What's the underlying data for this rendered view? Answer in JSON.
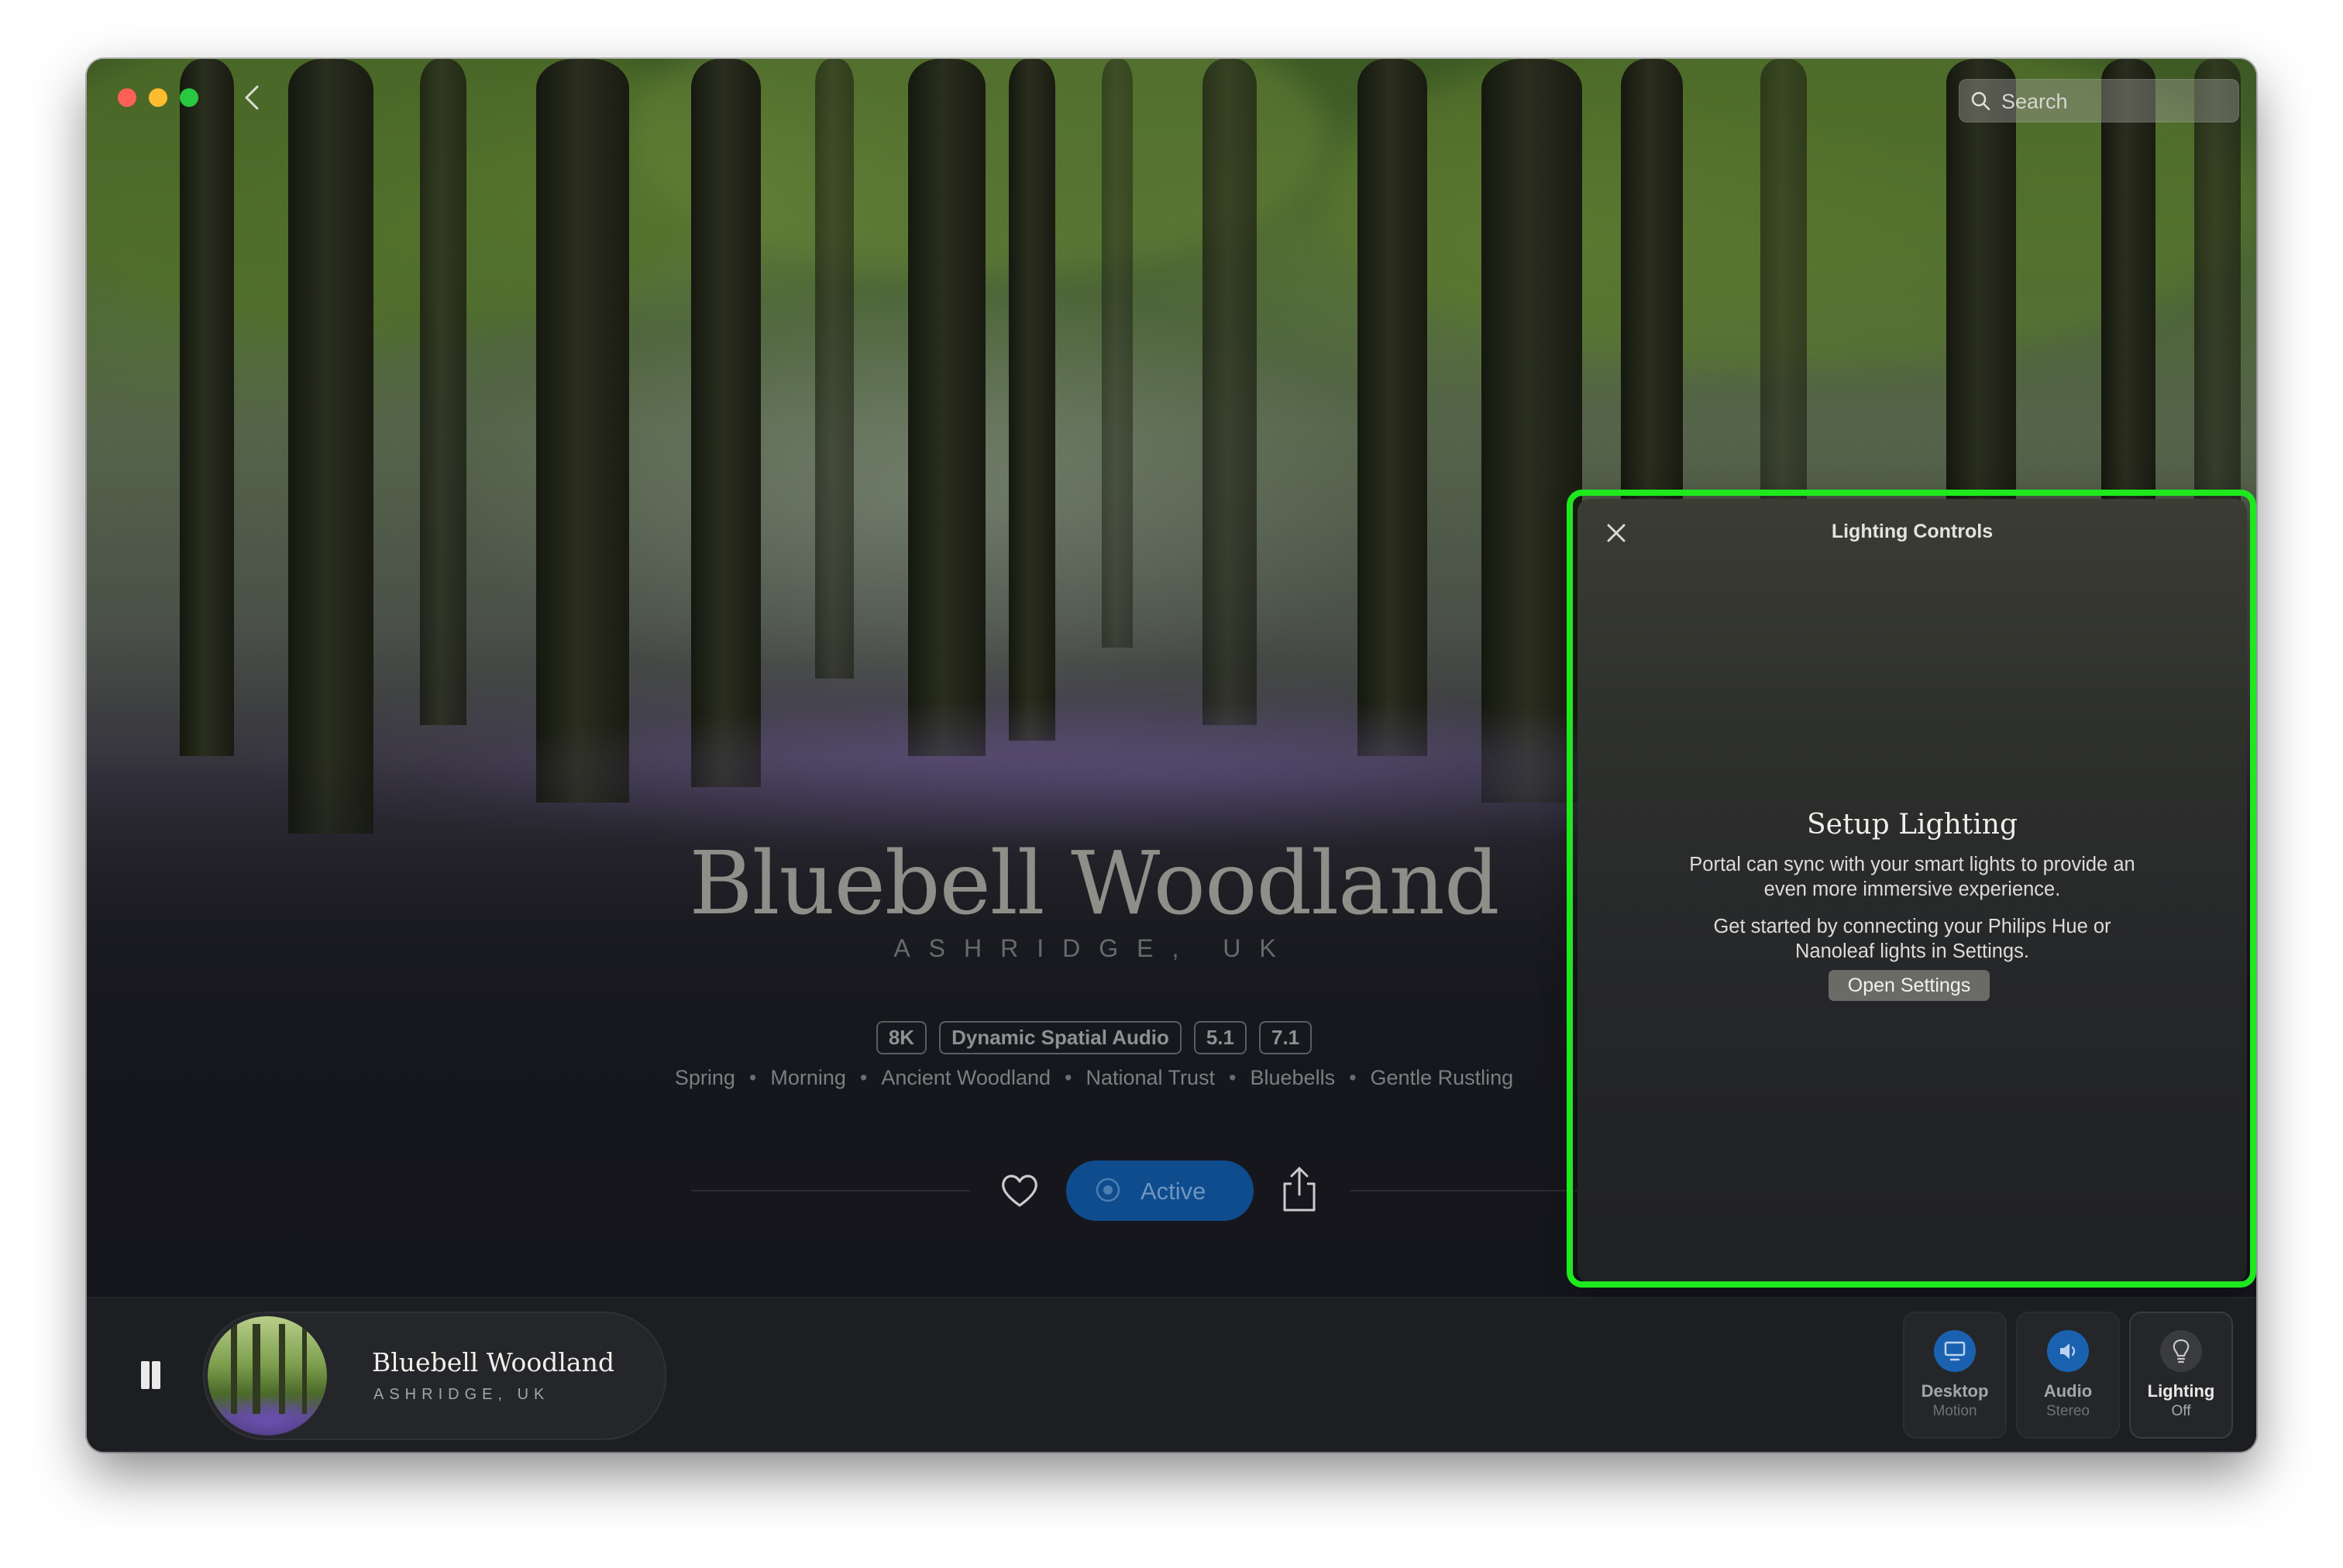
{
  "titlebar": {
    "back_label": "‹",
    "search_placeholder": "Search"
  },
  "hero": {
    "title": "Bluebell Woodland",
    "subtitle": "ASHRIDGE, UK",
    "badges": [
      "8K",
      "Dynamic Spatial Audio",
      "5.1",
      "7.1"
    ],
    "tags": [
      "Spring",
      "Morning",
      "Ancient Woodland",
      "National Trust",
      "Bluebells",
      "Gentle Rustling"
    ]
  },
  "actions": {
    "active_label": "Active"
  },
  "lighting_panel": {
    "title": "Lighting Controls",
    "heading": "Setup Lighting",
    "paragraph_1": "Portal can sync with your smart lights to provide an even more immersive experience.",
    "paragraph_2": "Get started by connecting your Philips Hue or Nanoleaf lights in Settings.",
    "button_label": "Open Settings"
  },
  "now_playing": {
    "title": "Bluebell Woodland",
    "subtitle": "ASHRIDGE, UK"
  },
  "controls": [
    {
      "label": "Desktop",
      "status": "Motion",
      "icon": "monitor-icon",
      "color": "#1a62b0"
    },
    {
      "label": "Audio",
      "status": "Stereo",
      "icon": "speaker-icon",
      "color": "#1a62b0"
    },
    {
      "label": "Lighting",
      "status": "Off",
      "icon": "lightbulb-icon",
      "color": "#3a3b3f"
    }
  ],
  "colors": {
    "accent": "#0e4c8e",
    "highlight": "#1ee81e",
    "traffic_red": "#fe5f57",
    "traffic_yellow": "#febc2e",
    "traffic_green": "#28c840"
  }
}
